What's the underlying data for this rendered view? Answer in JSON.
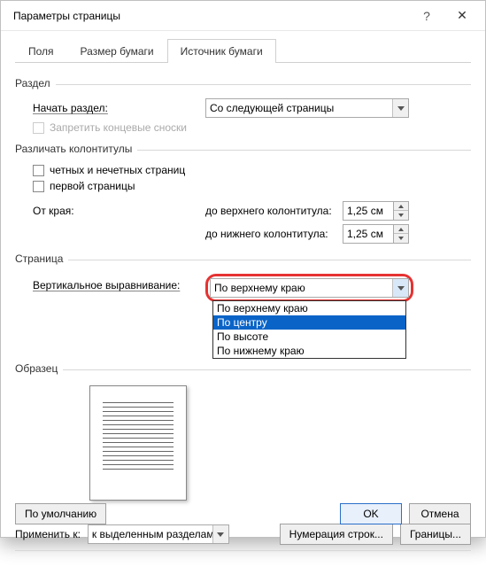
{
  "title": "Параметры страницы",
  "tabs": {
    "t0": "Поля",
    "t1": "Размер бумаги",
    "t2": "Источник бумаги"
  },
  "section": {
    "razdel": "Раздел",
    "start_label": "Начать раздел:",
    "start_value": "Со следующей страницы",
    "suppress_endnotes": "Запретить концевые сноски",
    "headers_footers": "Различать колонтитулы",
    "odd_even": "четных и нечетных страниц",
    "first_page": "первой страницы",
    "from_edge": "От края:",
    "to_header": "до верхнего колонтитула:",
    "to_footer": "до нижнего колонтитула:",
    "header_val": "1,25 см",
    "footer_val": "1,25 см"
  },
  "page": {
    "label": "Страница",
    "valign_label": "Вертикальное выравнивание:",
    "valign_value": "По верхнему краю",
    "valign_options": {
      "o0": "По верхнему краю",
      "o1": "По центру",
      "o2": "По высоте",
      "o3": "По нижнему краю"
    }
  },
  "sample": {
    "label": "Образец"
  },
  "apply": {
    "label": "Применить к:",
    "value": "к выделенным разделам",
    "line_numbers": "Нумерация строк...",
    "borders": "Границы..."
  },
  "buttons": {
    "default": "По умолчанию",
    "ok": "OK",
    "cancel": "Отмена"
  }
}
